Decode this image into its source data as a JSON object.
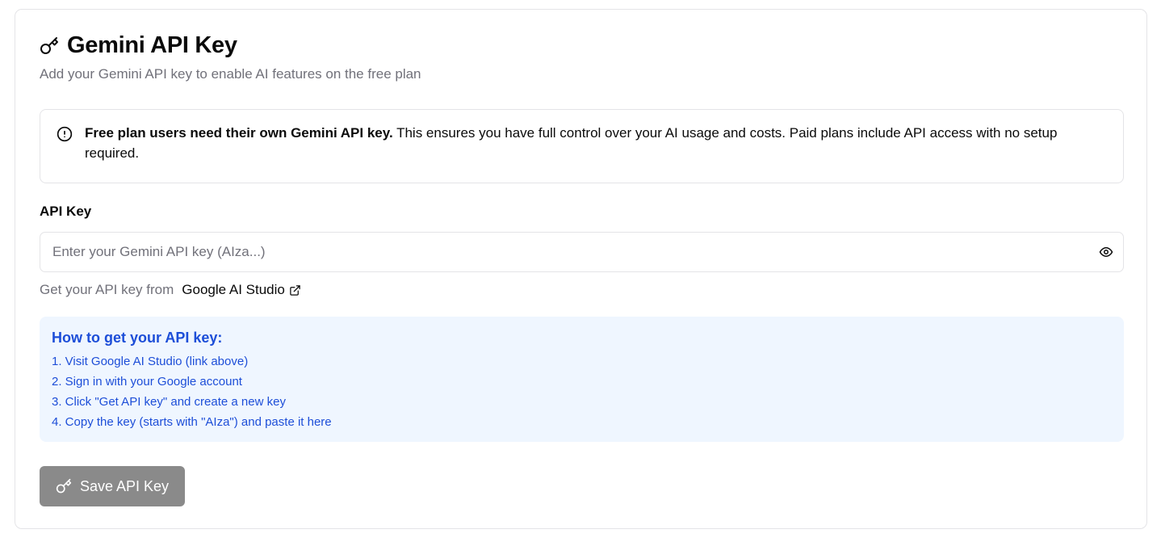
{
  "header": {
    "icon": "key-icon",
    "title": "Gemini API Key",
    "subtitle": "Add your Gemini API key to enable AI features on the free plan"
  },
  "alert": {
    "icon": "alert-circle-icon",
    "bold_text": "Free plan users need their own Gemini API key.",
    "text": " This ensures you have full control over your AI usage and costs. Paid plans include API access with no setup required."
  },
  "api_key_field": {
    "label": "API Key",
    "value": "",
    "placeholder": "Enter your Gemini API key (AIza...)",
    "toggle_icon": "eye-icon"
  },
  "hint": {
    "text": "Get your API key from",
    "link_label": "Google AI Studio",
    "link_icon": "external-link-icon"
  },
  "howto": {
    "title": "How to get your API key:",
    "steps": [
      "1. Visit Google AI Studio (link above)",
      "2. Sign in with your Google account",
      "3. Click \"Get API key\" and create a new key",
      "4. Copy the key (starts with \"AIza\") and paste it here"
    ]
  },
  "save_button": {
    "icon": "key-icon",
    "label": "Save API Key"
  },
  "colors": {
    "howto_bg": "#eff6ff",
    "howto_text": "#1d4ed8",
    "button_bg": "#8a8a8a",
    "muted_text": "#71717a",
    "border": "#e4e4e7"
  }
}
